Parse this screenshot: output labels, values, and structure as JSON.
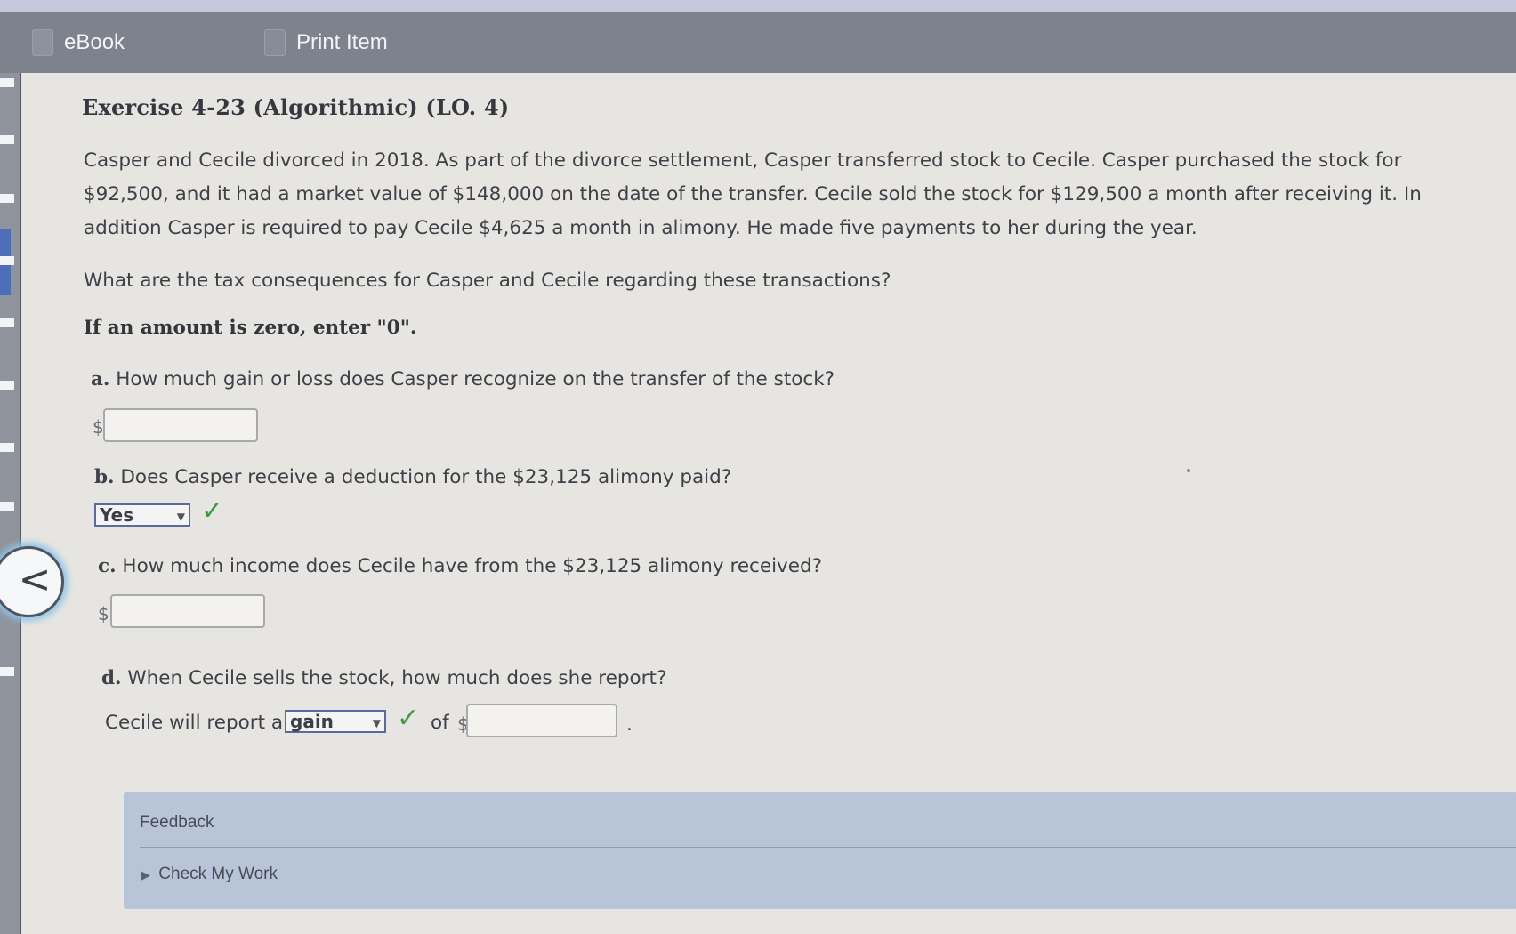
{
  "toolbar": {
    "ebook_label": "eBook",
    "print_label": "Print Item"
  },
  "exercise": {
    "title": "Exercise 4-23 (Algorithmic) (LO. 4)",
    "paragraph1": "Casper and Cecile divorced in 2018. As part of the divorce settlement, Casper transferred stock to Cecile. Casper purchased the stock for $92,500, and it had a market value of $148,000 on the date of the transfer. Cecile sold the stock for $129,500 a month after receiving it. In addition Casper is required to pay Cecile $4,625 a month in alimony. He made five payments to her during the year.",
    "paragraph2": "What are the tax consequences for Casper and Cecile regarding these transactions?",
    "instruction": "If an amount is zero, enter \"0\"."
  },
  "questions": {
    "a": {
      "letter": "a.",
      "text": "How much gain or loss does Casper recognize on the transfer of the stock?",
      "currency": "$",
      "value": ""
    },
    "b": {
      "letter": "b.",
      "text": "Does Casper receive a deduction for the $23,125 alimony paid?",
      "selected": "Yes",
      "status": "correct"
    },
    "c": {
      "letter": "c.",
      "text": "How much income does Cecile have from the $23,125 alimony received?",
      "currency": "$",
      "value": ""
    },
    "d": {
      "letter": "d.",
      "text": "When Cecile sells the stock, how much does she report?",
      "prefix": "Cecile will report a",
      "selected": "gain",
      "status": "correct",
      "of_label": "of",
      "currency": "$",
      "value": "",
      "suffix": "."
    }
  },
  "feedback": {
    "label": "Feedback",
    "check_label": "Check My Work"
  },
  "icons": {
    "ebook": "book-icon",
    "print": "print-icon",
    "back": "chevron-left-icon",
    "check": "checkmark-icon",
    "expand": "triangle-right-icon"
  },
  "colors": {
    "toolbar_bg": "#7e828d",
    "content_bg": "#e7e5e1",
    "feedback_bg": "#b8c5d8",
    "check_green": "#3f9a48"
  }
}
